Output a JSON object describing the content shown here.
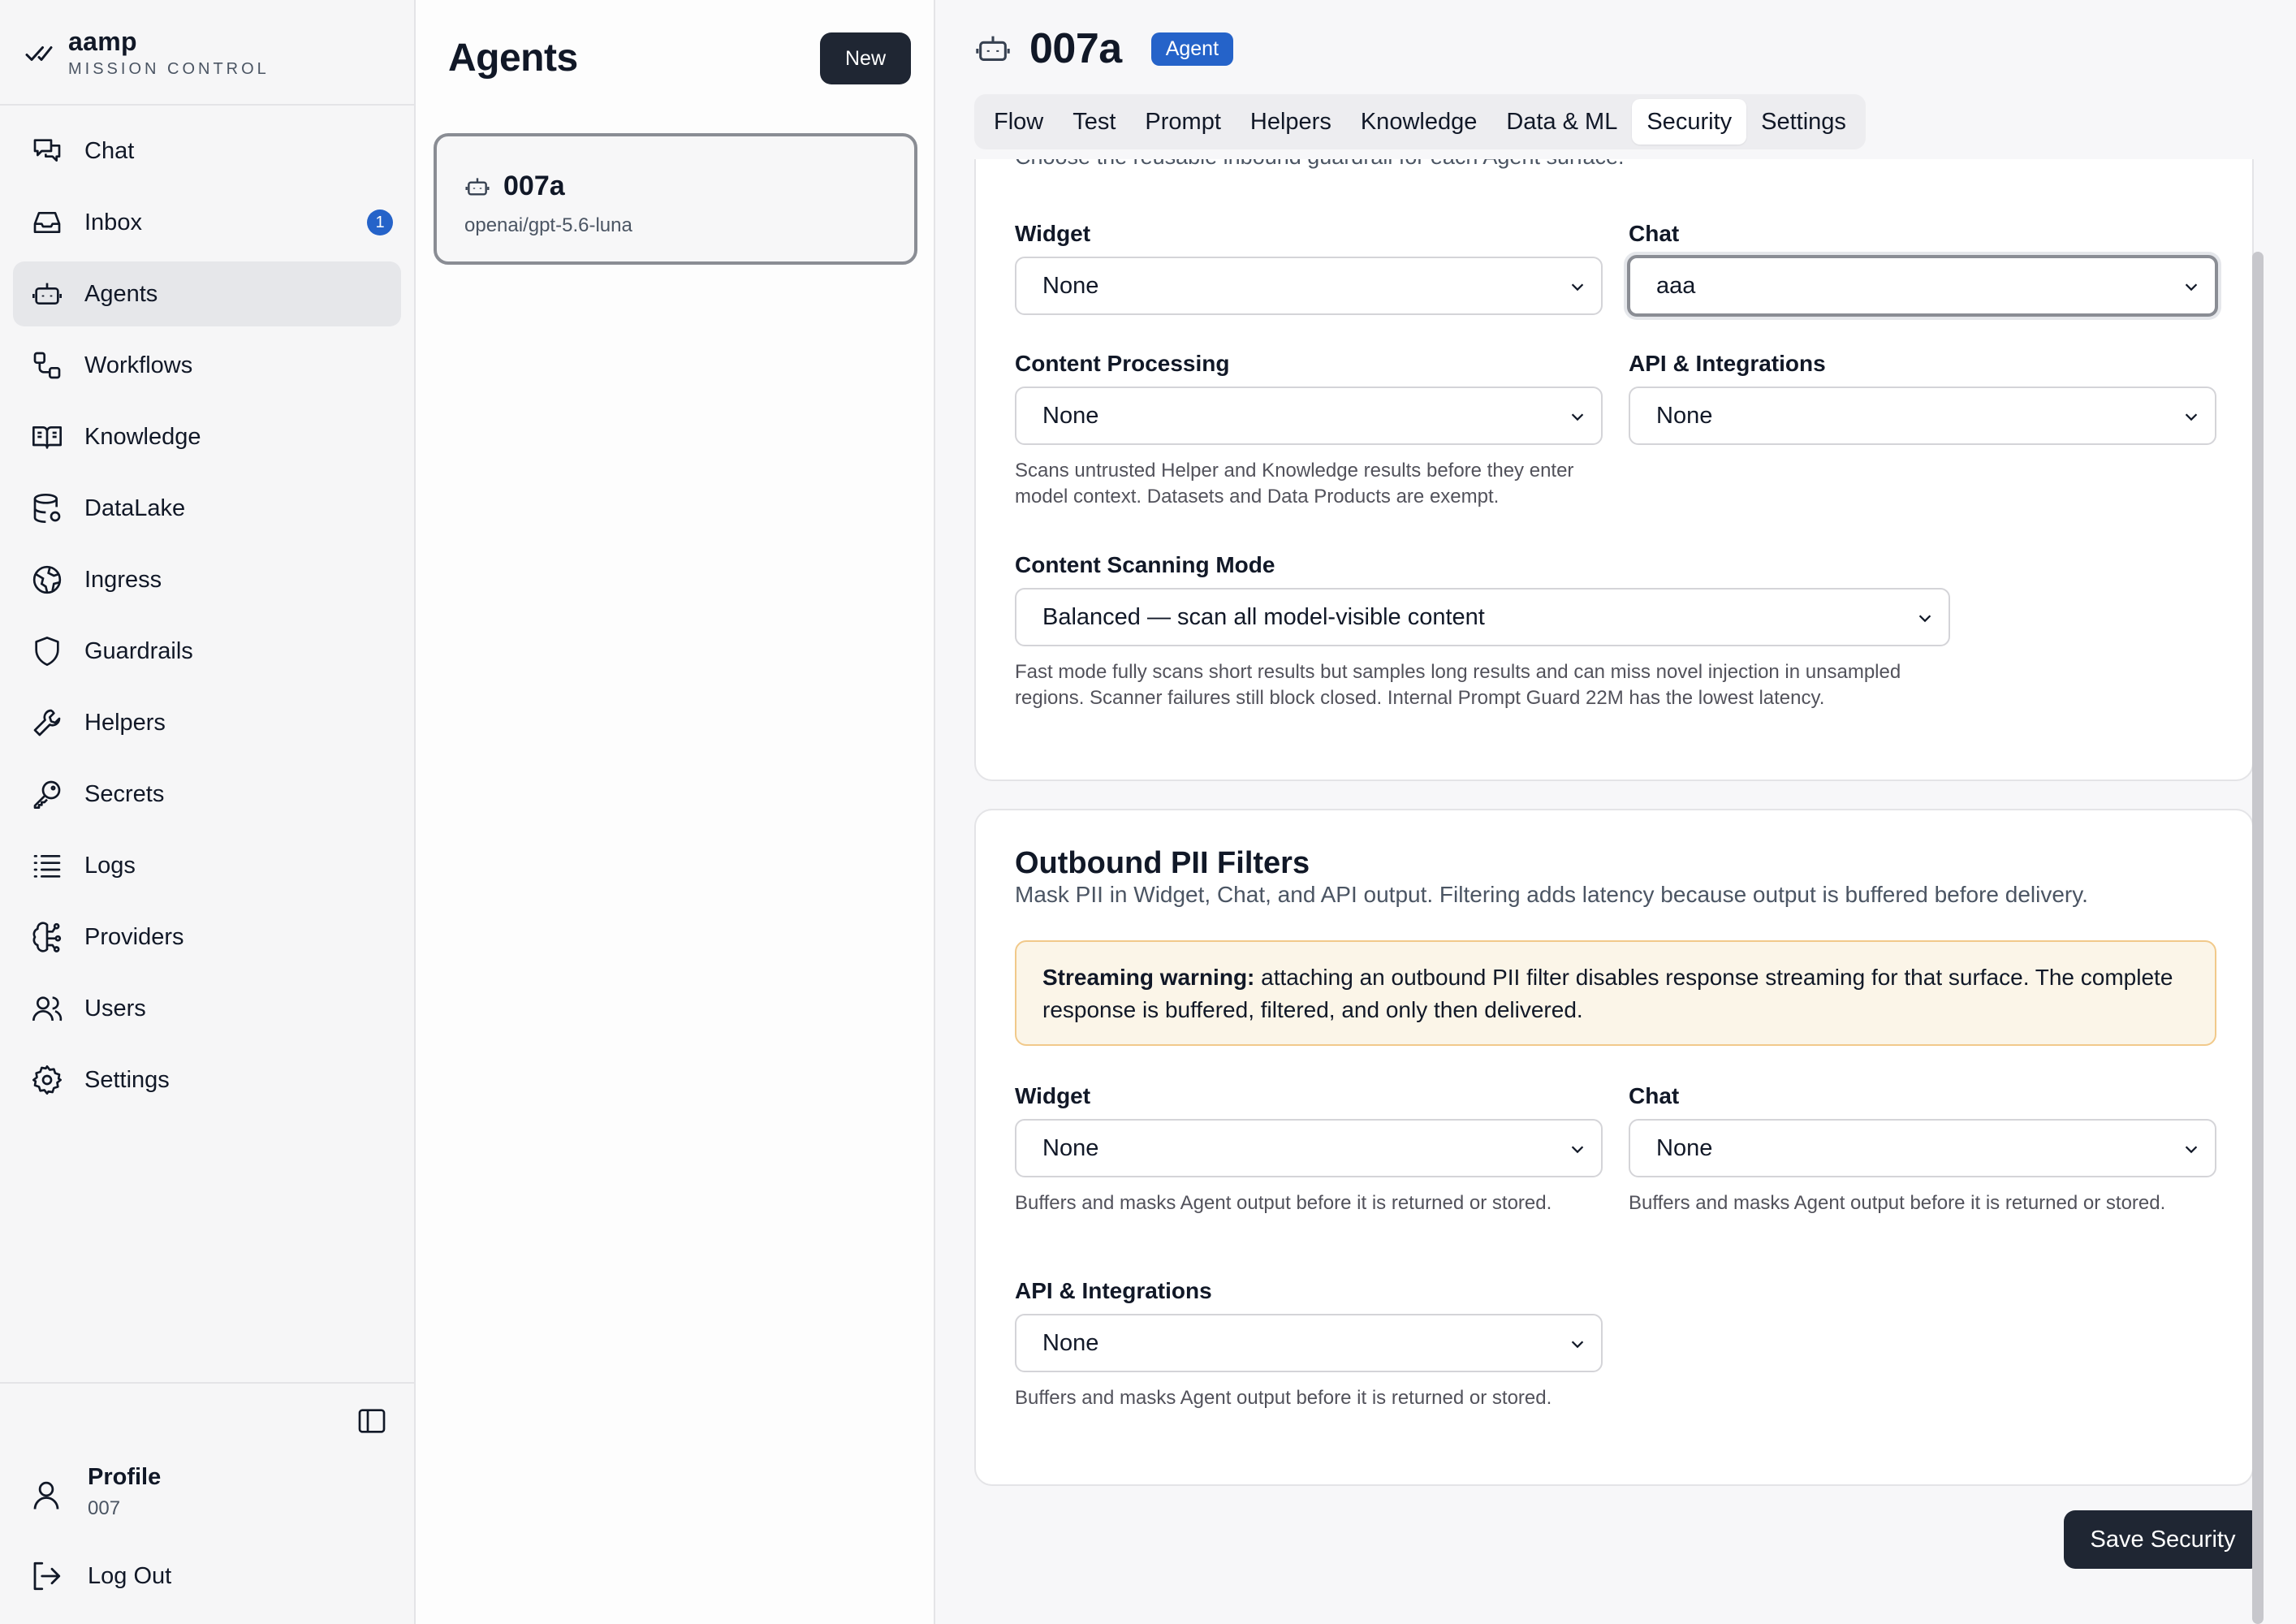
{
  "brand": {
    "name": "aamp",
    "subtitle": "MISSION CONTROL"
  },
  "sidebar": {
    "items": [
      {
        "label": "Chat",
        "icon": "chat-icon"
      },
      {
        "label": "Inbox",
        "icon": "inbox-icon",
        "badge": "1"
      },
      {
        "label": "Agents",
        "icon": "robot-icon",
        "active": true
      },
      {
        "label": "Workflows",
        "icon": "workflow-icon"
      },
      {
        "label": "Knowledge",
        "icon": "book-icon"
      },
      {
        "label": "DataLake",
        "icon": "database-icon"
      },
      {
        "label": "Ingress",
        "icon": "globe-icon"
      },
      {
        "label": "Guardrails",
        "icon": "shield-icon"
      },
      {
        "label": "Helpers",
        "icon": "wrench-icon"
      },
      {
        "label": "Secrets",
        "icon": "key-icon"
      },
      {
        "label": "Logs",
        "icon": "list-icon"
      },
      {
        "label": "Providers",
        "icon": "brain-icon"
      },
      {
        "label": "Users",
        "icon": "users-icon"
      },
      {
        "label": "Settings",
        "icon": "gear-icon"
      }
    ],
    "profile": {
      "name": "Profile",
      "sub": "007"
    },
    "logout": "Log Out"
  },
  "agents_panel": {
    "title": "Agents",
    "new_label": "New",
    "items": [
      {
        "name": "007a",
        "model": "openai/gpt-5.6-luna"
      }
    ]
  },
  "header": {
    "title": "007a",
    "badge": "Agent"
  },
  "tabs": [
    "Flow",
    "Test",
    "Prompt",
    "Helpers",
    "Knowledge",
    "Data & ML",
    "Security",
    "Settings"
  ],
  "active_tab": "Security",
  "inbound": {
    "intro": "Choose the reusable inbound guardrail for each Agent surface.",
    "widget_label": "Widget",
    "widget_value": "None",
    "chat_label": "Chat",
    "chat_value": "aaa",
    "content_label": "Content Processing",
    "content_value": "None",
    "api_label": "API & Integrations",
    "api_value": "None",
    "content_help": "Scans untrusted Helper and Knowledge results before they enter model context. Datasets and Data Products are exempt.",
    "scan_label": "Content Scanning Mode",
    "scan_value": "Balanced — scan all model-visible content",
    "scan_help": "Fast mode fully scans short results but samples long results and can miss novel injection in unsampled regions. Scanner failures still block closed. Internal Prompt Guard 22M has the lowest latency."
  },
  "outbound": {
    "title": "Outbound PII Filters",
    "subtitle": "Mask PII in Widget, Chat, and API output. Filtering adds latency because output is buffered before delivery.",
    "warning_bold": "Streaming warning:",
    "warning_text": " attaching an outbound PII filter disables response streaming for that surface. The complete response is buffered, filtered, and only then delivered.",
    "widget_label": "Widget",
    "widget_value": "None",
    "chat_label": "Chat",
    "chat_value": "None",
    "api_label": "API & Integrations",
    "api_value": "None",
    "help": "Buffers and masks Agent output before it is returned or stored."
  },
  "save_label": "Save Security",
  "colors": {
    "accent": "#2563c9",
    "dark_button": "#1f2633",
    "warning_bg": "#fbf5e8",
    "warning_border": "#f1c98a"
  }
}
